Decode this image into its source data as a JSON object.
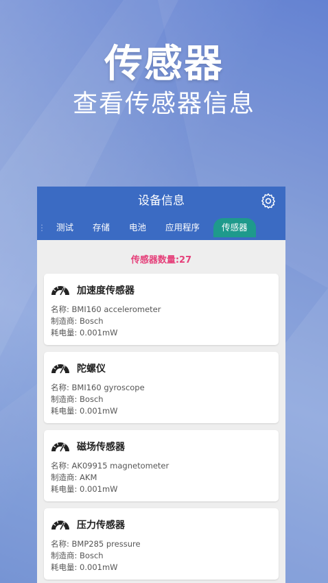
{
  "hero": {
    "title": "传感器",
    "subtitle": "查看传感器信息"
  },
  "appbar": {
    "title": "设备信息",
    "settings_icon": "gear-icon"
  },
  "tabs": [
    {
      "label": "测试"
    },
    {
      "label": "存储"
    },
    {
      "label": "电池"
    },
    {
      "label": "应用程序"
    },
    {
      "label": "传感器",
      "active": true
    }
  ],
  "sensor_count": "传感器数量:27",
  "sensors": [
    {
      "icon": "gauge-icon",
      "name": "加速度传感器",
      "model": "名称: BMI160 accelerometer",
      "vendor": "制造商: Bosch",
      "power": "耗电量: 0.001mW"
    },
    {
      "icon": "gauge-icon",
      "name": "陀螺仪",
      "model": "名称: BMI160 gyroscope",
      "vendor": "制造商: Bosch",
      "power": "耗电量: 0.001mW"
    },
    {
      "icon": "gauge-icon",
      "name": "磁场传感器",
      "model": "名称: AK09915 magnetometer",
      "vendor": "制造商: AKM",
      "power": "耗电量: 0.001mW"
    },
    {
      "icon": "gauge-icon",
      "name": "压力传感器",
      "model": "名称: BMP285 pressure",
      "vendor": "制造商: Bosch",
      "power": "耗电量: 0.001mW"
    }
  ],
  "colors": {
    "appbar": "#3b6bc3",
    "active_tab": "#1e9a8c",
    "count_text": "#e5407a"
  }
}
